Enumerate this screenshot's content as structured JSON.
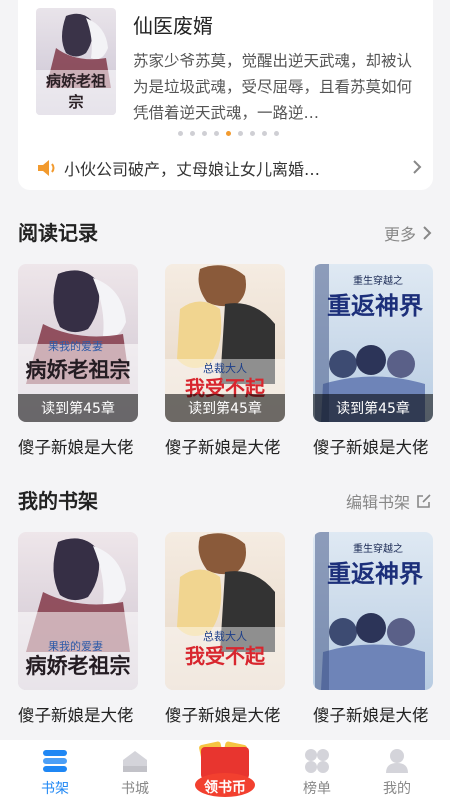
{
  "featured": {
    "title": "仙医废婿",
    "description": "苏家少爷苏莫，觉醒出逆天武魂，却被认为是垃圾武魂，受尽屈辱，且看苏莫如何凭借着逆天武魂，一路逆…",
    "cover_title": "病娇老祖宗",
    "carousel_count": 8,
    "carousel_active": 4
  },
  "notice": {
    "text": "小伙公司破产，丈母娘让女儿离婚…"
  },
  "reading_history": {
    "title": "阅读记录",
    "more_label": "更多",
    "books": [
      {
        "title": "傻子新娘是大佬",
        "progress": "读到第45章",
        "cover_text": "病娇老祖宗",
        "cover_sub": "果我的爱妻"
      },
      {
        "title": "傻子新娘是大佬",
        "progress": "读到第45章",
        "cover_text": "我受不起",
        "cover_sub": "总裁大人"
      },
      {
        "title": "傻子新娘是大佬",
        "progress": "读到第45章",
        "cover_text": "重返神界",
        "cover_sub": "重生穿越之"
      }
    ]
  },
  "bookshelf": {
    "title": "我的书架",
    "edit_label": "编辑书架",
    "books": [
      {
        "title": "傻子新娘是大佬",
        "cover_text": "病娇老祖宗",
        "cover_sub": "果我的爱妻"
      },
      {
        "title": "傻子新娘是大佬",
        "cover_text": "我受不起",
        "cover_sub": "总裁大人"
      },
      {
        "title": "傻子新娘是大佬",
        "cover_text": "重返神界",
        "cover_sub": "重生穿越之"
      }
    ]
  },
  "nav": {
    "items": [
      {
        "label": "书架",
        "icon": "bookshelf-icon",
        "active": true
      },
      {
        "label": "书城",
        "icon": "bookstore-icon",
        "active": false
      },
      {
        "label": "榜单",
        "icon": "ranking-icon",
        "active": false
      },
      {
        "label": "我的",
        "icon": "profile-icon",
        "active": false
      }
    ],
    "promo_label": "领书币"
  },
  "colors": {
    "accent": "#1f87f4",
    "notice_orange": "#f29a2e",
    "promo_red": "#e8352f"
  }
}
